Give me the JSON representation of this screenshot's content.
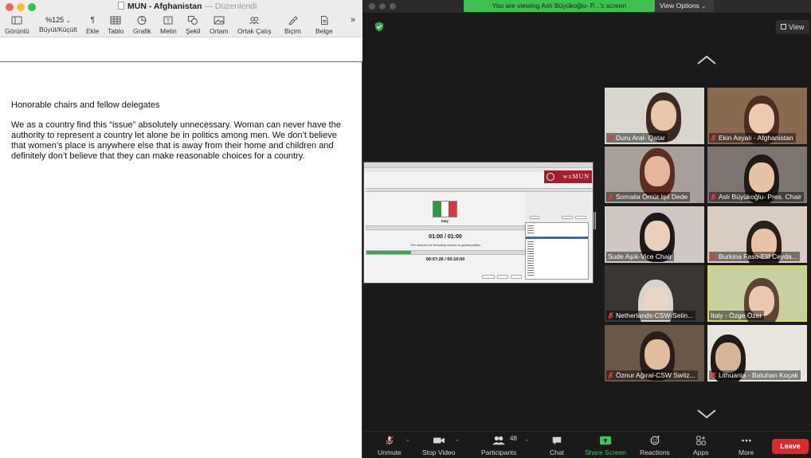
{
  "pages": {
    "title": "MUN - Afghanistan",
    "separator": "—",
    "status": "Düzenlendi",
    "toolbar": {
      "view_label": "Görüntü",
      "zoom_value": "%125",
      "zoom_label": "Büyüt/Küçült",
      "insert_label": "Ekle",
      "table_label": "Tablo",
      "chart_label": "Grafik",
      "text_label": "Metin",
      "shape_label": "Şekil",
      "media_label": "Ortam",
      "collaborate_label": "Ortak Çalış",
      "format_label": "Biçim",
      "document_label": "Belge",
      "more_symbol": "»"
    },
    "body": {
      "paragraph1": "Honorable chairs and fellow delegates",
      "paragraph2": "We as a country find this “issue” absolutely unnecessary. Woman can never have the authority to represent a country let alone be in politics among men. We don’t believe that women’s place is anywhere else that is away from their home and children and definitely don’t believe that they can make reasonable choices for a country."
    }
  },
  "zoom": {
    "viewing_banner": "You are viewing Aslı Büyükoğlu- P...'s screen",
    "view_options": "View Options",
    "view_button": "View",
    "shared_screen": {
      "logo_text": "wxMUN",
      "country": "Italy",
      "speaker_timer": "01:00 / 01:00",
      "topic": "The reasons for including women in global politics",
      "total_timer": "00:07:26 / 00:10:00",
      "progress": 0.2
    },
    "participants": [
      {
        "name": "Duru Aral- Qatar",
        "muted": true
      },
      {
        "name": "Ekin Asyalı - Afghanistan",
        "muted": true
      },
      {
        "name": "Somalia Ömür Işıl Dede",
        "muted": true
      },
      {
        "name": "Aslı Büyükoğlu- Pres. Chair",
        "muted": true
      },
      {
        "name": "Sude Aşık-Vice Chair",
        "muted": false
      },
      {
        "name": "Burkina Faso-Elif Ceyda...",
        "muted": true
      },
      {
        "name": "Netherlands-CSW-Selin...",
        "muted": true
      },
      {
        "name": "Italy - Özge Özer",
        "muted": false
      },
      {
        "name": "Öznur Ağıral-CSW Switz...",
        "muted": true
      },
      {
        "name": "Lithuania - Batuhan Koçak",
        "muted": true
      }
    ],
    "controls": {
      "unmute": "Unmute",
      "stop_video": "Stop Video",
      "participants": "Participants",
      "participants_count": "48",
      "chat": "Chat",
      "share_screen": "Share Screen",
      "reactions": "Reactions",
      "apps": "Apps",
      "more": "More",
      "leave": "Leave"
    },
    "colors": {
      "banner": "#3fbf4f",
      "leave": "#e02828",
      "share_screen": "#3fc65a",
      "active_speaker": "#e0d84a"
    }
  }
}
